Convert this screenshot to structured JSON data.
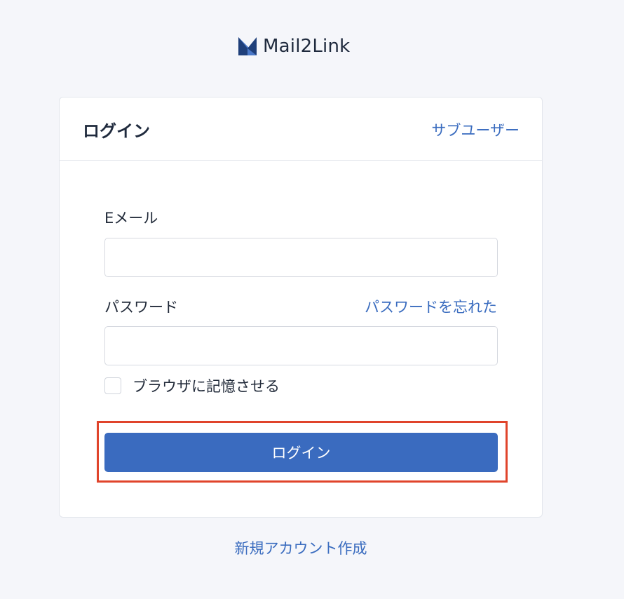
{
  "brand": {
    "name": "Mail2Link",
    "logo_icon": "mail2link-logo-icon",
    "colors": {
      "logo_dark": "#1f3f7a",
      "logo_light": "#4a78c8"
    }
  },
  "card": {
    "title": "ログイン",
    "subuser_link": "サブユーザー"
  },
  "form": {
    "email_label": "Eメール",
    "email_value": "",
    "password_label": "パスワード",
    "password_value": "",
    "forgot_link": "パスワードを忘れた",
    "remember_label": "ブラウザに記憶させる",
    "remember_checked": false,
    "submit_label": "ログイン"
  },
  "footer": {
    "signup_link": "新規アカウント作成"
  },
  "colors": {
    "background": "#f5f6fa",
    "primary": "#3a6bbf",
    "link": "#3a6cbf",
    "highlight": "#e0442b"
  }
}
